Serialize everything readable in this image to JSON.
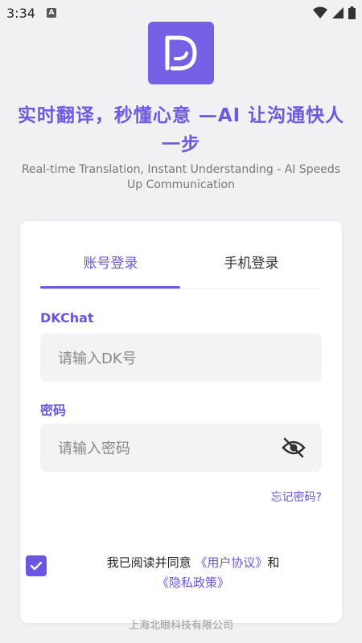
{
  "status_bar": {
    "time": "3:34",
    "notif_letter": "A"
  },
  "brand": {
    "accent": "#6c55e0",
    "logo_bg": "#7461e6"
  },
  "slogan_cn": "实时翻译，秒懂心意 —AI 让沟通快人一步",
  "slogan_en": "Real-time Translation, Instant Understanding - AI Speeds Up Communication",
  "tabs": [
    {
      "label": "账号登录",
      "active": true
    },
    {
      "label": "手机登录",
      "active": false
    }
  ],
  "account_field": {
    "label": "DKChat",
    "placeholder": "请输入DK号",
    "value": ""
  },
  "password_field": {
    "label": "密码",
    "placeholder": "请输入密码",
    "value": ""
  },
  "forgot_password": "忘记密码?",
  "agreement": {
    "checked": true,
    "text_before": "我已阅读并同意 ",
    "user_agreement": "《用户协议》",
    "and": "和",
    "privacy_policy": "《隐私政策》"
  },
  "footer": "上海北眼科技有限公司",
  "icons": [
    "wifi-icon",
    "signal-icon",
    "battery-icon",
    "eye-off-icon",
    "check-icon"
  ]
}
